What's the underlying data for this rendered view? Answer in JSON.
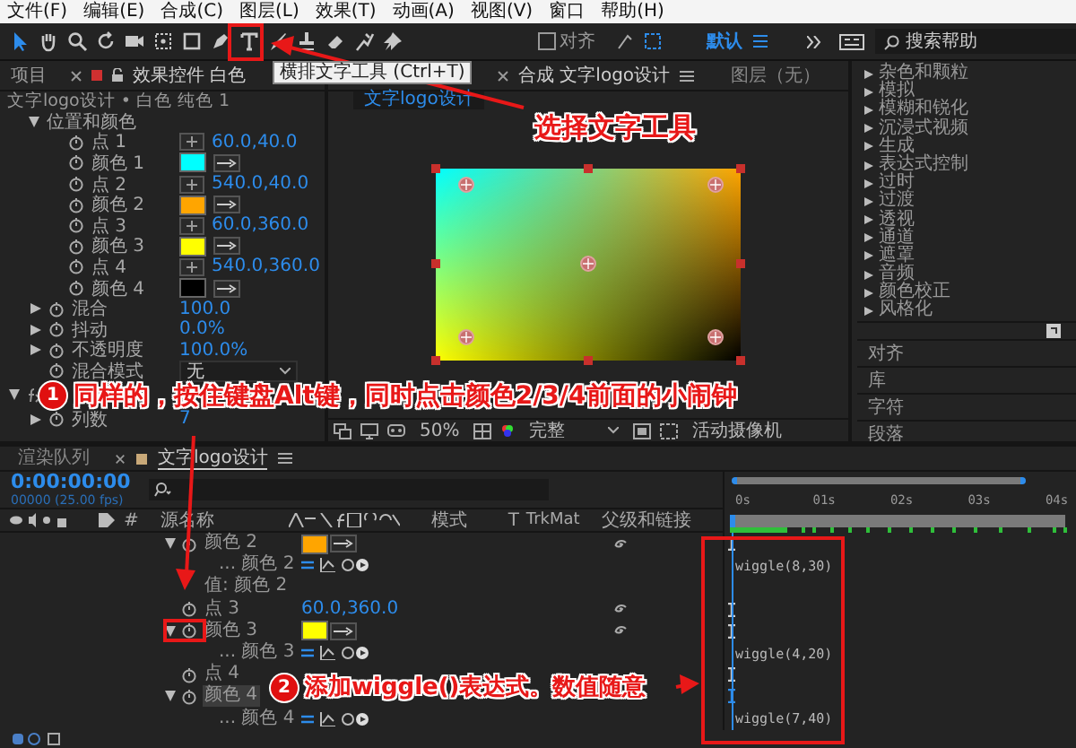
{
  "menu": [
    "文件(F)",
    "编辑(E)",
    "合成(C)",
    "图层(L)",
    "效果(T)",
    "动画(A)",
    "视图(V)",
    "窗口",
    "帮助(H)"
  ],
  "tools": [
    {
      "kind": "select",
      "selected": true
    },
    {
      "kind": "hand",
      "selected": false
    },
    {
      "kind": "zoom",
      "selected": false
    },
    {
      "kind": "rotate",
      "selected": false
    },
    {
      "kind": "camera",
      "selected": false
    },
    {
      "kind": "pan",
      "selected": false
    },
    {
      "kind": "rect",
      "selected": false
    },
    {
      "kind": "pen",
      "selected": false
    },
    {
      "kind": "text",
      "selected": false
    },
    {
      "kind": "brush",
      "selected": false
    },
    {
      "kind": "stamp",
      "selected": false
    },
    {
      "kind": "eraser",
      "selected": false
    },
    {
      "kind": "roto",
      "selected": false
    },
    {
      "kind": "pin",
      "selected": false
    }
  ],
  "snap": {
    "label": "对齐",
    "checked": false
  },
  "workspace": {
    "label": "默认"
  },
  "help_search": {
    "placeholder": "搜索帮助"
  },
  "tooltip": "横排文字工具 (Ctrl+T)",
  "effect_panel": {
    "tabs": [
      {
        "label": "项目",
        "selected": false
      },
      {
        "label": "效果控件 白色",
        "selected": true
      }
    ],
    "subtitle": "文字logo设计 • 白色 纯色 1",
    "group": {
      "name": "位置和颜色",
      "expanded": true
    },
    "rows": [
      {
        "kind": "point",
        "name": "点 1",
        "value": "60.0,40.0"
      },
      {
        "kind": "color",
        "name": "颜色 1",
        "color": "#00ffff"
      },
      {
        "kind": "point",
        "name": "点 2",
        "value": "540.0,40.0"
      },
      {
        "kind": "color",
        "name": "颜色 2",
        "color": "#ffa500"
      },
      {
        "kind": "point",
        "name": "点 3",
        "value": "60.0,360.0"
      },
      {
        "kind": "color",
        "name": "颜色 3",
        "color": "#ffff00"
      },
      {
        "kind": "point",
        "name": "点 4",
        "value": "540.0,360.0"
      },
      {
        "kind": "color",
        "name": "颜色 4",
        "color": "#000000"
      },
      {
        "kind": "number",
        "name": "混合",
        "value": "100.0",
        "expanded": false
      },
      {
        "kind": "number",
        "name": "抖动",
        "value": "0.0%",
        "expanded": false
      },
      {
        "kind": "number",
        "name": "不透明度",
        "value": "100.0%",
        "expanded": false
      },
      {
        "kind": "dropdown",
        "name": "混合模式",
        "value": "无"
      },
      {
        "kind": "fx",
        "expanded": true
      },
      {
        "kind": "number",
        "name": "列数",
        "value": "7",
        "expanded": false
      }
    ]
  },
  "viewer": {
    "tab": {
      "label": "合成 文字logo设计",
      "selected": true
    },
    "layer_tab": "图层（无）",
    "comp_label": "文字logo设计",
    "zoom": "50%",
    "resolution": "完整",
    "camera": "活动摄像机"
  },
  "effects_list": [
    "杂色和颗粒",
    "模拟",
    "模糊和锐化",
    "沉浸式视频",
    "生成",
    "表达式控制",
    "过时",
    "过渡",
    "透视",
    "通道",
    "遮罩",
    "音频",
    "颜色校正",
    "风格化"
  ],
  "panels": [
    "对齐",
    "库",
    "字符",
    "段落"
  ],
  "timeline": {
    "tabs": [
      {
        "label": "渲染队列",
        "selected": false
      },
      {
        "label": "文字logo设计",
        "selected": true
      }
    ],
    "time": "0:00:00:00",
    "fps": "00000 (25.00 fps)",
    "columns": {
      "number": "#",
      "source": "源名称",
      "mode": "模式",
      "t": "T",
      "trkmat": "TrkMat",
      "parent": "父级和链接"
    },
    "ruler": [
      "0s",
      "01s",
      "02s",
      "03s",
      "04s"
    ],
    "rows": [
      {
        "kind": "color",
        "name": "颜色 2",
        "expanded": true,
        "color": "#ffa500",
        "selected": false
      },
      {
        "kind": "expression",
        "name": "... 颜色 2",
        "expression": "wiggle(8,30)",
        "selected": false
      },
      {
        "kind": "label",
        "name": "值: 颜色 2",
        "selected": false
      },
      {
        "kind": "point",
        "name": "点 3",
        "value": "60.0,360.0",
        "selected": false
      },
      {
        "kind": "color",
        "name": "颜色 3",
        "expanded": true,
        "color": "#ffff00",
        "selected": false
      },
      {
        "kind": "expression",
        "name": "... 颜色 3",
        "expression": "wiggle(4,20)",
        "selected": false
      },
      {
        "kind": "point",
        "name": "点 4",
        "selected": false
      },
      {
        "kind": "color",
        "name": "颜色 4",
        "expanded": true,
        "selected": true
      },
      {
        "kind": "expression",
        "name": "... 颜色 4",
        "expression": "wiggle(7,40)",
        "selected": false
      }
    ]
  },
  "annotations": {
    "title": "选择文字工具",
    "steps": [
      {
        "number": "1",
        "text": "同样的，按住键盘Alt键，同时点击颜色2/3/4前面的小闹钟"
      },
      {
        "number": "2",
        "text": "添加wiggle()表达式。数值随意"
      }
    ]
  }
}
